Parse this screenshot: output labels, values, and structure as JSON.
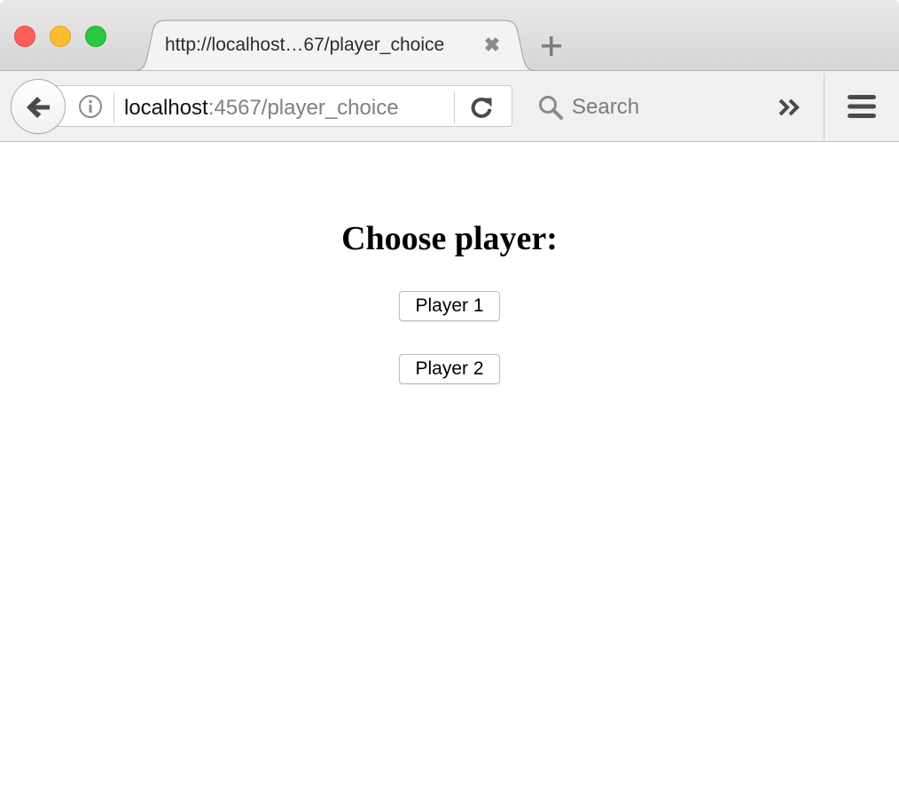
{
  "browser": {
    "tab": {
      "title": "http://localhost…67/player_choice",
      "close_glyph": "✖"
    },
    "url": {
      "host": "localhost",
      "rest": ":4567/player_choice"
    },
    "search": {
      "placeholder": "Search"
    },
    "icons": {
      "back": "back-arrow-icon",
      "info": "info-icon",
      "reload": "reload-icon",
      "search": "search-icon",
      "overflow": "chevron-double-right-icon",
      "menu": "hamburger-menu-icon",
      "new_tab": "plus-icon"
    },
    "colors": {
      "traffic_close": "#fc5f57",
      "traffic_minimize": "#fdbc2e",
      "traffic_maximize": "#29c840"
    }
  },
  "page": {
    "title": "Choose player:",
    "buttons": [
      {
        "label": "Player 1"
      },
      {
        "label": "Player 2"
      }
    ]
  }
}
